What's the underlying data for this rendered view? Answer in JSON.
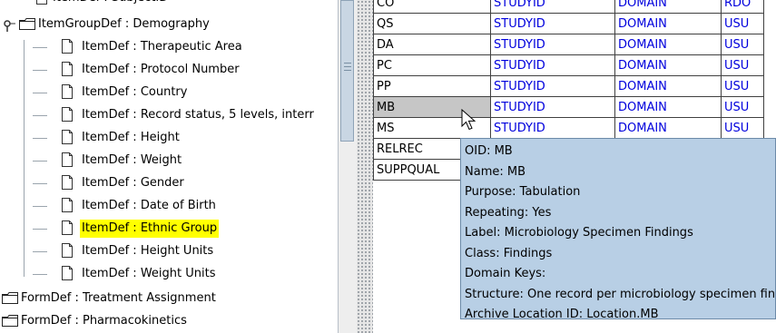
{
  "tree": {
    "top_partial_label": "ItemDef : SubjectID",
    "group_label": "ItemGroupDef : Demography",
    "items": [
      "ItemDef : Therapeutic Area",
      "ItemDef : Protocol Number",
      "ItemDef : Country",
      "ItemDef : Record status, 5 levels, interr",
      "ItemDef : Height",
      "ItemDef : Weight",
      "ItemDef : Gender",
      "ItemDef : Date of Birth",
      "ItemDef : Ethnic Group",
      "ItemDef : Height Units",
      "ItemDef : Weight Units"
    ],
    "forms": [
      "FormDef : Treatment Assignment",
      "FormDef : Pharmacokinetics"
    ],
    "selected_item": "ItemDef : Ethnic Group",
    "highlight_color": "#ffff00"
  },
  "grid": {
    "rows": [
      [
        "CO",
        "STUDYID",
        "DOMAIN",
        "RDO"
      ],
      [
        "QS",
        "STUDYID",
        "DOMAIN",
        "USU"
      ],
      [
        "DA",
        "STUDYID",
        "DOMAIN",
        "USU"
      ],
      [
        "PC",
        "STUDYID",
        "DOMAIN",
        "USU"
      ],
      [
        "PP",
        "STUDYID",
        "DOMAIN",
        "USU"
      ],
      [
        "MB",
        "STUDYID",
        "DOMAIN",
        "USU"
      ],
      [
        "MS",
        "STUDYID",
        "DOMAIN",
        "USU"
      ],
      [
        "RELREC",
        "",
        "",
        ""
      ],
      [
        "SUPPQUAL",
        "",
        "",
        ""
      ]
    ],
    "selected_row": "MB",
    "link_color": "#0000dd"
  },
  "tooltip": {
    "oid": "OID: MB",
    "name": "Name: MB",
    "purpose": "Purpose: Tabulation",
    "repeating": "Repeating: Yes",
    "label": "Label: Microbiology Specimen Findings",
    "class": "Class: Findings",
    "domain_keys": "Domain Keys:",
    "structure": "Structure: One record per microbiology specimen finding",
    "archive": "Archive Location ID: Location.MB",
    "background": "#b8cfe5"
  }
}
